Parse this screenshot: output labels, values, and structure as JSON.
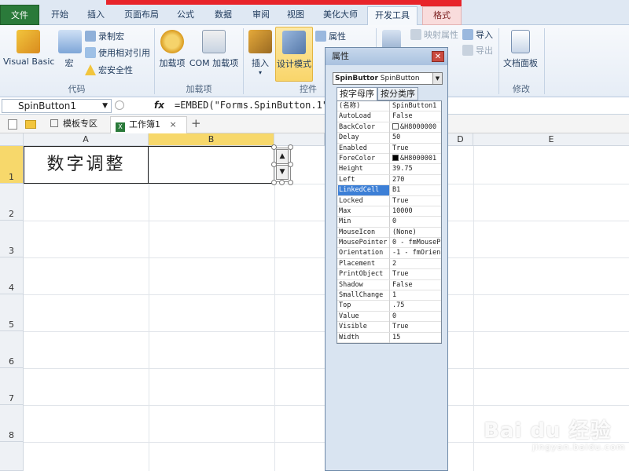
{
  "ribbon": {
    "tabs": [
      "文件",
      "开始",
      "插入",
      "页面布局",
      "公式",
      "数据",
      "审阅",
      "视图",
      "美化大师",
      "开发工具",
      "格式"
    ],
    "active_tab": "开发工具",
    "groups": {
      "code": {
        "label": "代码",
        "visual_basic": "Visual Basic",
        "macro": "宏",
        "record_macro": "录制宏",
        "relative_ref": "使用相对引用",
        "macro_security": "宏安全性"
      },
      "addins": {
        "label": "加载项",
        "addins_btn": "加载项",
        "com_addins": "COM 加载项"
      },
      "controls": {
        "label": "控件",
        "insert": "插入",
        "design_mode": "设计模式",
        "properties": "属性"
      },
      "xml": {
        "map_props": "映射属性",
        "import": "导入",
        "export": "导出"
      },
      "modify": {
        "label": "修改",
        "doc_panel": "文档面板"
      }
    }
  },
  "formula_bar": {
    "name_box": "SpinButton1",
    "fx": "fx",
    "formula": "=EMBED(\"Forms.SpinButton.1\""
  },
  "doc_tabs": {
    "templates": "模板专区",
    "workbook": "工作簿1",
    "close": "×",
    "add": "+"
  },
  "grid": {
    "columns": [
      "A",
      "B",
      "D",
      "E"
    ],
    "rows": [
      "1",
      "2",
      "3",
      "4",
      "5",
      "6",
      "7",
      "8"
    ],
    "cell_a1": "数字调整"
  },
  "properties_window": {
    "title": "属性",
    "close": "✕",
    "object_combo_name": "SpinButtor",
    "object_combo_type": "SpinButton",
    "tab_alpha": "按字母序",
    "tab_category": "按分类序",
    "rows": [
      {
        "name": "(名称)",
        "value": "SpinButton1"
      },
      {
        "name": "AutoLoad",
        "value": "False"
      },
      {
        "name": "BackColor",
        "value": "&H8000000",
        "swatch": "#ffffff"
      },
      {
        "name": "Delay",
        "value": "50"
      },
      {
        "name": "Enabled",
        "value": "True"
      },
      {
        "name": "ForeColor",
        "value": "&H8000001",
        "swatch": "#000000"
      },
      {
        "name": "Height",
        "value": "39.75"
      },
      {
        "name": "Left",
        "value": "270"
      },
      {
        "name": "LinkedCell",
        "value": "B1",
        "selected": true
      },
      {
        "name": "Locked",
        "value": "True"
      },
      {
        "name": "Max",
        "value": "10000"
      },
      {
        "name": "Min",
        "value": "0"
      },
      {
        "name": "MouseIcon",
        "value": "(None)"
      },
      {
        "name": "MousePointer",
        "value": "0 - fmMouseP"
      },
      {
        "name": "Orientation",
        "value": "-1 - fmOrien"
      },
      {
        "name": "Placement",
        "value": "2"
      },
      {
        "name": "PrintObject",
        "value": "True"
      },
      {
        "name": "Shadow",
        "value": "False"
      },
      {
        "name": "SmallChange",
        "value": "1"
      },
      {
        "name": "Top",
        "value": ".75"
      },
      {
        "name": "Value",
        "value": "0"
      },
      {
        "name": "Visible",
        "value": "True"
      },
      {
        "name": "Width",
        "value": "15"
      }
    ]
  },
  "watermark": {
    "logo": "Bai du 经验",
    "url": "jingyan.baidu.com"
  },
  "colors": {
    "file_tab": "#2a7a3a",
    "accent_red": "#e8242a",
    "selected_header": "#f7d86b",
    "selection_blue": "#3c7fd6"
  }
}
